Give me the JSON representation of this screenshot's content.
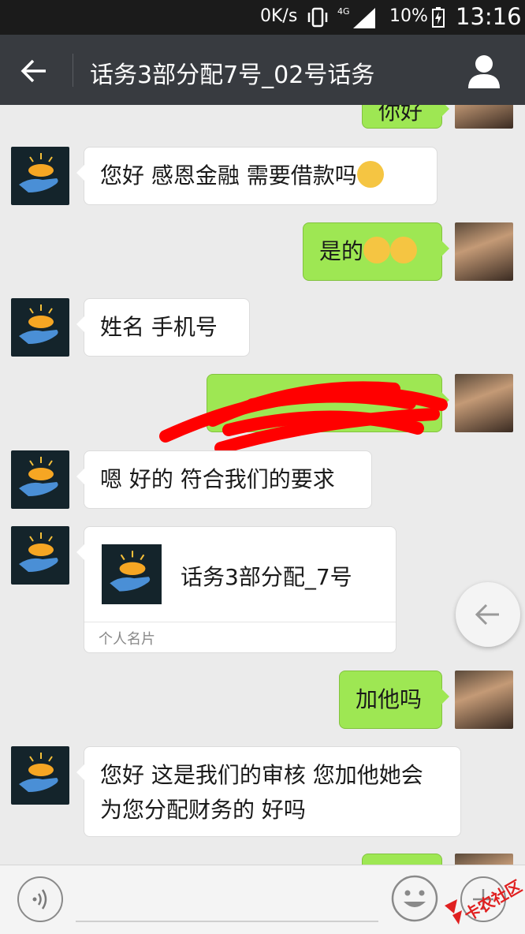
{
  "status_bar": {
    "network_speed": "0K/s",
    "network_type": "4G",
    "battery": "10%",
    "time": "13:16"
  },
  "header": {
    "title": "话务3部分配7号_02号话务"
  },
  "messages": [
    {
      "side": "right",
      "text": "你好"
    },
    {
      "side": "left",
      "text": "您好  感恩金融  需要借款吗"
    },
    {
      "side": "right",
      "text": "是的"
    },
    {
      "side": "left",
      "text": "姓名  手机号"
    },
    {
      "side": "right",
      "text": "",
      "redacted": true
    },
    {
      "side": "left",
      "text": "嗯  好的  符合我们的要求"
    },
    {
      "side": "left",
      "type": "contact_card",
      "name": "话务3部分配_7号",
      "card_label": "个人名片"
    },
    {
      "side": "right",
      "text": "加他吗"
    },
    {
      "side": "left",
      "text": "您好  这是我们的审核  您加他她会为您分配财务的  好吗"
    }
  ],
  "watermark": "卡农社区",
  "colors": {
    "status_bar_bg": "#1b1b1b",
    "title_bar_bg": "#383b40",
    "chat_bg": "#ebebeb",
    "outgoing_bubble": "#9ee753",
    "incoming_bubble": "#ffffff"
  },
  "icons": {
    "back": "back-arrow-icon",
    "profile": "person-icon",
    "voice": "voice-icon",
    "emoji": "emoji-icon",
    "plus": "plus-icon",
    "float_back": "back-arrow-icon"
  }
}
